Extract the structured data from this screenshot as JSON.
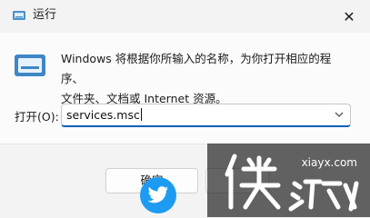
{
  "window": {
    "title": "运行",
    "close_glyph": "✕"
  },
  "description": {
    "line1": "Windows 将根据你所输入的名称，为你打开相应的程序、",
    "line2": "文件夹、文档或 Internet 资源。"
  },
  "open_field": {
    "label": "打开(O):",
    "value": "services.msc",
    "dropdown_icon": "chevron-down-icon"
  },
  "buttons": {
    "ok_label": "确定",
    "cancel_label": ""
  },
  "overlay": {
    "share_icon": "twitter-bird-icon",
    "watermark_text": "xiayx.com",
    "watermark_logo": "侠游戏"
  },
  "colors": {
    "accent": "#005fb8",
    "twitter": "#1d9bf0"
  }
}
